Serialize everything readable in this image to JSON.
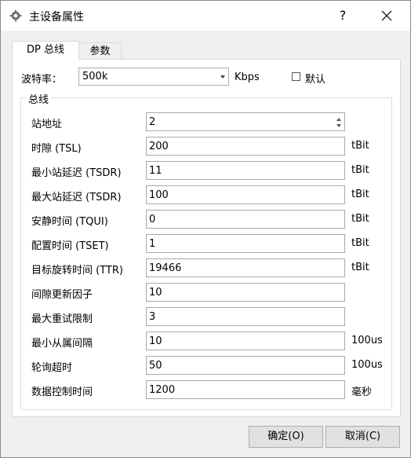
{
  "window": {
    "title": "主设备属性",
    "help_label": "?"
  },
  "tabs": [
    {
      "label": "DP 总线",
      "active": true
    },
    {
      "label": "参数",
      "active": false
    }
  ],
  "baud": {
    "label": "波特率：",
    "value": "500k",
    "unit": "Kbps",
    "default_label": "默认",
    "default_checked": false
  },
  "group": {
    "title": "总线",
    "rows": [
      {
        "label": "站地址",
        "value": "2",
        "unit": ""
      },
      {
        "label": "时隙 (TSL)",
        "value": "200",
        "unit": "tBit"
      },
      {
        "label": "最小站延迟 (TSDR)",
        "value": "11",
        "unit": "tBit"
      },
      {
        "label": "最大站延迟 (TSDR)",
        "value": "100",
        "unit": "tBit"
      },
      {
        "label": "安静时间 (TQUI)",
        "value": "0",
        "unit": "tBit"
      },
      {
        "label": "配置时间 (TSET)",
        "value": "1",
        "unit": "tBit"
      },
      {
        "label": "目标旋转时间 (TTR)",
        "value": "19466",
        "unit": "tBit"
      },
      {
        "label": "间隙更新因子",
        "value": "10",
        "unit": ""
      },
      {
        "label": "最大重试限制",
        "value": "3",
        "unit": ""
      },
      {
        "label": "最小从属间隔",
        "value": "10",
        "unit": "100us"
      },
      {
        "label": "轮询超时",
        "value": "50",
        "unit": "100us"
      },
      {
        "label": "数据控制时间",
        "value": "1200",
        "unit": "毫秒"
      }
    ]
  },
  "buttons": {
    "ok": "确定(O)",
    "cancel": "取消(C)"
  }
}
